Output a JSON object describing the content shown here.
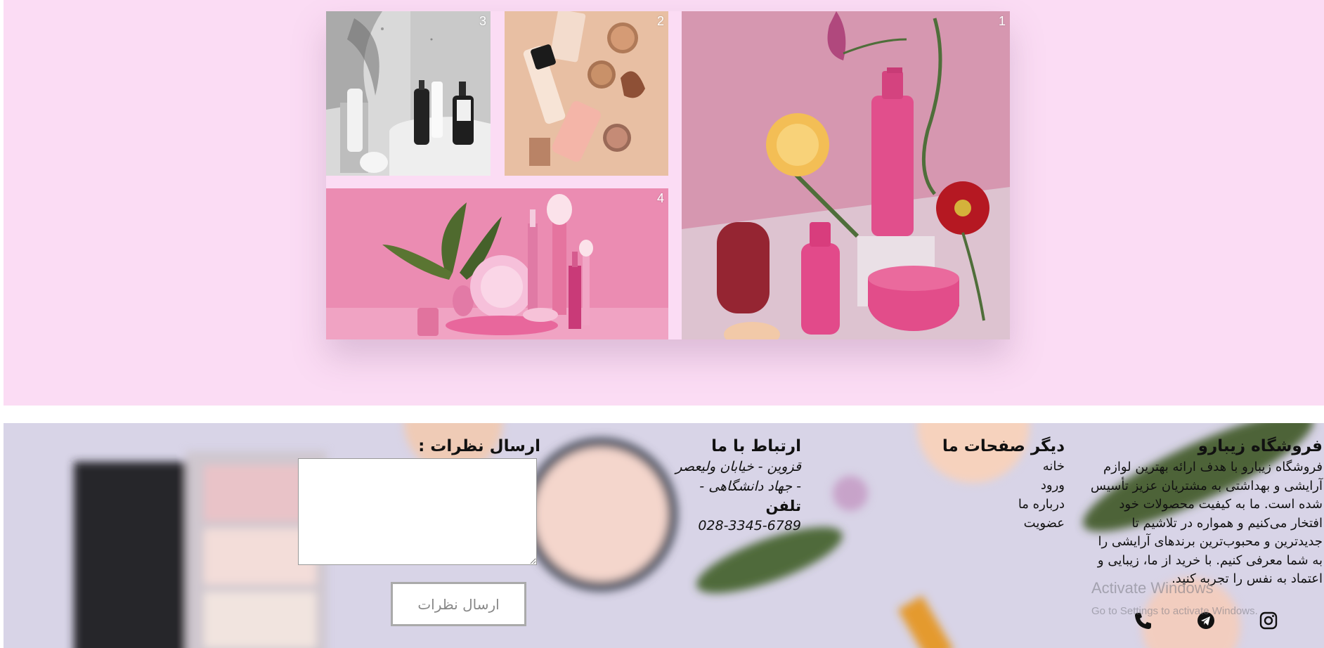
{
  "gallery": {
    "tiles": [
      {
        "number": "1",
        "subject": "pink cosmetics bottles with flowers"
      },
      {
        "number": "2",
        "subject": "foundation and powders on beige"
      },
      {
        "number": "3",
        "subject": "grayscale skincare bottles"
      },
      {
        "number": "4",
        "subject": "pink makeup brushes and jars"
      }
    ]
  },
  "footer": {
    "about": {
      "title": "فروشگاه زیبارو",
      "text": "فروشگاه زیبارو با هدف ارائه بهترین لوازم آرایشی و بهداشتی به مشتریان عزیز تأسیس شده است. ما به کیفیت محصولات خود افتخار می‌کنیم و همواره در تلاشیم تا جدیدترین و محبوب‌ترین برندهای آرایشی را به شما معرفی کنیم. با خرید از ما، زیبایی و اعتماد به نفس را تجربه کنید."
    },
    "pages": {
      "title": "دیگر صفحات ما",
      "links": [
        "خانه",
        "ورود",
        "درباره ما",
        "عضویت"
      ]
    },
    "contact": {
      "title": "ارتباط با ما",
      "address_line1": "قزوین - خیابان ولیعصر",
      "address_line2": "- جهاد دانشگاهی -",
      "phone_title": "تلفن",
      "phone": "028-3345-6789"
    },
    "comments": {
      "title": "ارسال نظرات :",
      "textarea_value": "",
      "submit_label": "ارسال نظرات"
    },
    "social_icons": [
      "instagram-icon",
      "telegram-icon",
      "phone-icon"
    ]
  },
  "watermark": {
    "line1": "Activate Windows",
    "line2": "Go to Settings to activate Windows."
  },
  "colors": {
    "top_background": "#fbdcf4",
    "footer_tint": "#d8d4e7",
    "accent_pink": "#e0508f"
  }
}
